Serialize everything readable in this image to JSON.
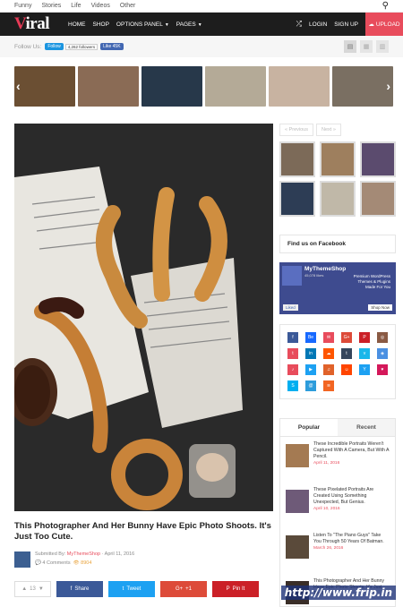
{
  "topbar": {
    "links": [
      "Funny",
      "Stories",
      "Life",
      "Videos",
      "Other"
    ]
  },
  "header": {
    "logo_first": "V",
    "logo_rest": "iral",
    "nav": [
      "HOME",
      "SHOP",
      "OPTIONS PANEL",
      "PAGES"
    ],
    "login": "LOGIN",
    "signup": "SIGN UP",
    "upload": "UPLOAD"
  },
  "follow": {
    "label": "Follow Us:",
    "twitter_btn": "Follow",
    "twitter_count": "4,262 followers",
    "fb_btn": "Like 45K"
  },
  "slider": {
    "thumb_colors": [
      "#6b4f33",
      "#8a6b55",
      "#27384a",
      "#b4aa97",
      "#c8b3a1",
      "#7a6f62"
    ]
  },
  "sidebar": {
    "prev": "« Previous",
    "next": "Next »",
    "thumb_colors": [
      "#7c6a58",
      "#9e7f5e",
      "#5b4b6e",
      "#2d3d55",
      "#c0b8a8",
      "#a48a76"
    ],
    "fb_box_title": "Find us on Facebook",
    "fb_page_name": "MyThemeShop",
    "fb_page_likes": "45,078 likes",
    "fb_page_tag": "Premium WordPress Themes & Plugins Made For You",
    "fb_liked": "Liked",
    "fb_shop": "Shop Now",
    "social": [
      {
        "label": "f",
        "color": "#3b5998"
      },
      {
        "label": "Be",
        "color": "#1769ff"
      },
      {
        "label": "✉",
        "color": "#e84c5c"
      },
      {
        "label": "G+",
        "color": "#dd4b39"
      },
      {
        "label": "P",
        "color": "#cb2027"
      },
      {
        "label": "◎",
        "color": "#8a5a44"
      },
      {
        "label": "t",
        "color": "#e84c5c"
      },
      {
        "label": "in",
        "color": "#0077b5"
      },
      {
        "label": "☁",
        "color": "#ff5500"
      },
      {
        "label": "t",
        "color": "#35465c"
      },
      {
        "label": "v",
        "color": "#1ab7ea"
      },
      {
        "label": "◈",
        "color": "#4a90e2"
      },
      {
        "label": "♪",
        "color": "#e84c5c"
      },
      {
        "label": "▶",
        "color": "#1da1f2"
      },
      {
        "label": "♫",
        "color": "#e0622a"
      },
      {
        "label": "☺",
        "color": "#ff4500"
      },
      {
        "label": "Y",
        "color": "#1da1f2"
      },
      {
        "label": "♥",
        "color": "#d4185a"
      },
      {
        "label": "S",
        "color": "#00aff0"
      },
      {
        "label": "@",
        "color": "#2d9cdb"
      },
      {
        "label": "≋",
        "color": "#f26522"
      }
    ],
    "tab_popular": "Popular",
    "tab_recent": "Recent",
    "posts": [
      {
        "title": "These Incredible Portraits Weren't Captured With A Camera, But With A Pencil.",
        "date": "April 11, 2016",
        "color": "#a47a52"
      },
      {
        "title": "These Pixelated Portraits Are Created Using Something Unexpected, But Genius.",
        "date": "April 10, 2016",
        "color": "#6e5a78"
      },
      {
        "title": "Listen To \"The Piano Guys\" Take You Through 50 Years Of Batman.",
        "date": "March 26, 2016",
        "color": "#5a4a3a"
      },
      {
        "title": "This Photographer And Her Bunny Have Epic Photo Shoots. It's Just Too Cute.",
        "date": "",
        "color": "#3a2e28"
      }
    ]
  },
  "article": {
    "title": "This Photographer And Her Bunny Have Epic Photo Shoots. It's Just Too Cute.",
    "submitted_by_label": "Submitted By:",
    "author": "MyThemeShop",
    "date": "April 11, 2016",
    "comments": "4 Comments",
    "views": "8904",
    "votes": "13",
    "share_buttons": [
      {
        "label": "Share",
        "icon": "f",
        "color": "#3b5998"
      },
      {
        "label": "Tweet",
        "icon": "t",
        "color": "#1da1f2"
      },
      {
        "label": "+1",
        "icon": "G+",
        "color": "#dd4b39"
      },
      {
        "label": "Pin It",
        "icon": "P",
        "color": "#cb2027"
      }
    ]
  },
  "watermark": "http://www.frip.in"
}
